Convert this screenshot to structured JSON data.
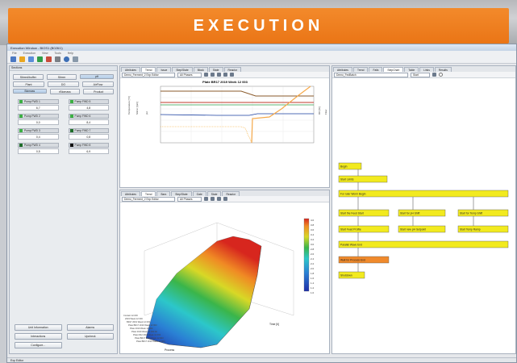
{
  "banner": {
    "title": "EXECUTION"
  },
  "window": {
    "title": "Execution Window - BIOS1 (B026/1)",
    "status": "Exp Editor"
  },
  "menu": [
    "File",
    "Execution",
    "View",
    "Tools",
    "Help"
  ],
  "left": {
    "header": "Sections",
    "mode_buttons": [
      [
        "Stirred/buffer",
        "Stirrer",
        "pH"
      ],
      [
        "Plant",
        "DO",
        "AirFlow"
      ],
      [
        "Biomass",
        "rBiomass",
        "Product"
      ]
    ],
    "pumps": [
      {
        "name": "Pump FWD 1",
        "value": "6,7"
      },
      {
        "name": "Pump FWD 5",
        "value": "4,8"
      },
      {
        "name": "Pump FWD 2",
        "value": "0,0"
      },
      {
        "name": "Pump FWD 6",
        "value": "8,4"
      },
      {
        "name": "Pump FWD 3",
        "value": "0,4"
      },
      {
        "name": "Pump FWD 7",
        "value": "0,8"
      },
      {
        "name": "Pump FWD 4",
        "value": "0,5"
      },
      {
        "name": "Pump FWD 8",
        "value": "6,9"
      }
    ],
    "bottom_buttons": [
      "Unit Information",
      "Alarms",
      "Interactions",
      "Upcheck",
      "Configure..."
    ]
  },
  "middle": {
    "top_tabs": [
      "Attributes",
      "Trend",
      "Issue",
      "Step/State",
      "Block",
      "State",
      "Reactor"
    ],
    "top_select": "Demo_Ferment_2 Exp Editor",
    "top_select2": "All Phases",
    "trend_title": "Plate BR17 2019 Week 12 003",
    "trend_ylabels": [
      "Temperature [°C]",
      "Stirrer [rpm]",
      "pH",
      "DO [%]",
      "Flow"
    ],
    "bottom_tabs": [
      "Attributes",
      "Trend",
      "Bars",
      "Step/State",
      "Gate",
      "State",
      "Reactor"
    ],
    "bottom_select": "Demo_Ferment_2 Exp Editor",
    "surface_xlabel": "Time [h]",
    "surface_ylabel": "Process",
    "legend_values": [
      "4.0",
      "3.8",
      "3.6",
      "3.4",
      "3.2",
      "3.0",
      "2.8",
      "2.6",
      "2.4",
      "2.2",
      "2.0",
      "1.8",
      "1.6",
      "1.4",
      "1.2",
      "1.0"
    ],
    "run_labels": [
      "Contact 12-003",
      "2019 Week 12 003",
      "BR17 2019 Week 12 003",
      "Plate BR17 2019 Week 12 003",
      "Plate 2019 Week 12 003",
      "Plate 2019 Week 12 003 Ab",
      "Plate M12 2019 Week 12 003",
      "Plate BR17 2019 Week 12 003",
      "Plate BR17 2019 Week 12 003"
    ]
  },
  "right": {
    "tabs": [
      "Attributes",
      "Trend",
      "Fails",
      "StepChart",
      "Table",
      "Links",
      "Results"
    ],
    "select": "Demo_FedBatch",
    "select2": "Start",
    "steps": [
      "Begin",
      "Start Limits",
      "For ruler Worm Begin",
      "Start the Feed Start",
      "Start for pH Shift",
      "Start for Temp Shift",
      "Start Feed Profile",
      "Start new pH Setpoint",
      "Start Temp Ramp",
      "Parallel Wave End",
      "Wait for Process End",
      "Shutdown"
    ]
  },
  "colors": {
    "banner": "#ee7e1f",
    "step": "#f2ea1f",
    "step_alert": "#f08a2c"
  }
}
